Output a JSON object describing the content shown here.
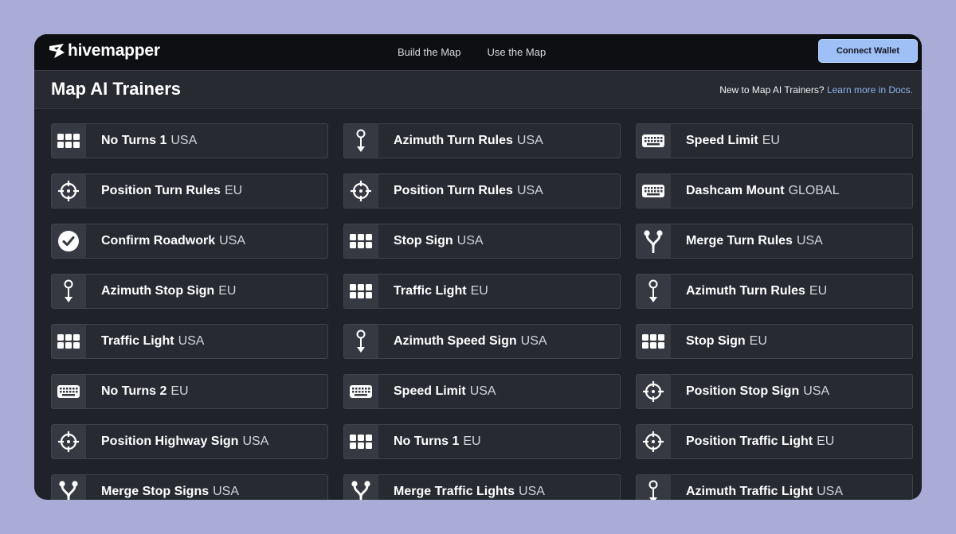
{
  "header": {
    "logo_text": "hivemapper",
    "nav": [
      "Build the Map",
      "Use the Map"
    ],
    "connect_label": "Connect Wallet"
  },
  "subheader": {
    "title": "Map AI Trainers",
    "docs_prompt": "New to Map AI Trainers?",
    "docs_link": "Learn more in Docs."
  },
  "trainers": [
    {
      "name": "No Turns 1",
      "region": "USA",
      "icon": "grid-icon"
    },
    {
      "name": "Azimuth Turn Rules",
      "region": "USA",
      "icon": "azimuth-pin-icon"
    },
    {
      "name": "Speed Limit",
      "region": "EU",
      "icon": "keyboard-icon"
    },
    {
      "name": "Position Turn Rules",
      "region": "EU",
      "icon": "crosshair-icon"
    },
    {
      "name": "Position Turn Rules",
      "region": "USA",
      "icon": "crosshair-icon"
    },
    {
      "name": "Dashcam Mount",
      "region": "GLOBAL",
      "icon": "keyboard-icon"
    },
    {
      "name": "Confirm Roadwork",
      "region": "USA",
      "icon": "check-circle-icon"
    },
    {
      "name": "Stop Sign",
      "region": "USA",
      "icon": "grid-icon"
    },
    {
      "name": "Merge Turn Rules",
      "region": "USA",
      "icon": "merge-icon"
    },
    {
      "name": "Azimuth Stop Sign",
      "region": "EU",
      "icon": "azimuth-pin-icon"
    },
    {
      "name": "Traffic Light",
      "region": "EU",
      "icon": "grid-icon"
    },
    {
      "name": "Azimuth Turn Rules",
      "region": "EU",
      "icon": "azimuth-pin-icon"
    },
    {
      "name": "Traffic Light",
      "region": "USA",
      "icon": "grid-icon"
    },
    {
      "name": "Azimuth Speed Sign",
      "region": "USA",
      "icon": "azimuth-pin-icon"
    },
    {
      "name": "Stop Sign",
      "region": "EU",
      "icon": "grid-icon"
    },
    {
      "name": "No Turns 2",
      "region": "EU",
      "icon": "keyboard-icon"
    },
    {
      "name": "Speed Limit",
      "region": "USA",
      "icon": "keyboard-icon"
    },
    {
      "name": "Position Stop Sign",
      "region": "USA",
      "icon": "crosshair-icon"
    },
    {
      "name": "Position Highway Sign",
      "region": "USA",
      "icon": "crosshair-icon"
    },
    {
      "name": "No Turns 1",
      "region": "EU",
      "icon": "grid-icon"
    },
    {
      "name": "Position Traffic Light",
      "region": "EU",
      "icon": "crosshair-icon"
    },
    {
      "name": "Merge Stop Signs",
      "region": "USA",
      "icon": "merge-icon"
    },
    {
      "name": "Merge Traffic Lights",
      "region": "USA",
      "icon": "merge-icon"
    },
    {
      "name": "Azimuth Traffic Light",
      "region": "USA",
      "icon": "azimuth-pin-icon"
    }
  ]
}
